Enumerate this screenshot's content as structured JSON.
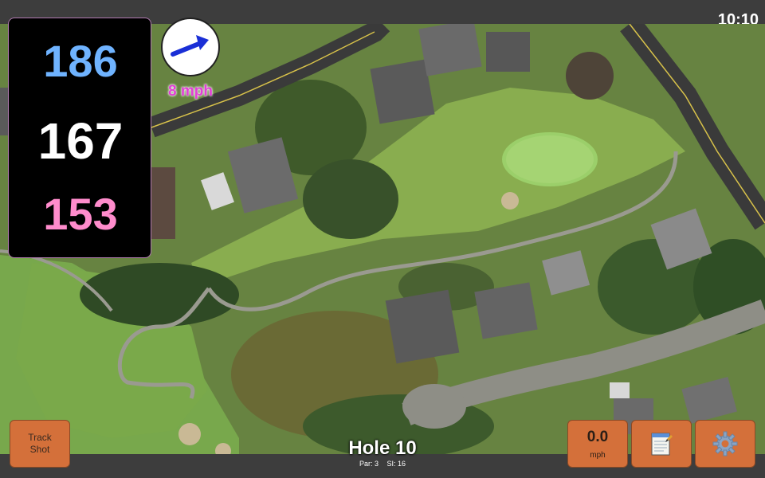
{
  "status_bar": {
    "time": "10:10"
  },
  "yardages": {
    "back": "186",
    "middle": "167",
    "front": "153",
    "colors": {
      "back": "#6fb3ff",
      "middle": "#ffffff",
      "front": "#ff8ccc"
    }
  },
  "wind": {
    "speed_label": "8 mph",
    "direction_icon": "arrow-icon",
    "color": "#e23fd6",
    "arrow_color": "#1a2fd6"
  },
  "hole": {
    "title": "Hole 10",
    "par_label": "Par: 3",
    "si_label": "SI: 16"
  },
  "buttons": {
    "track_shot_line1": "Track",
    "track_shot_line2": "Shot",
    "wind_value": "0.0",
    "wind_unit": "mph",
    "notes_icon": "notepad-icon",
    "settings_icon": "gear-icon"
  },
  "colors": {
    "button_bg": "#d4703a",
    "bar_bg": "#3d3d3d"
  }
}
